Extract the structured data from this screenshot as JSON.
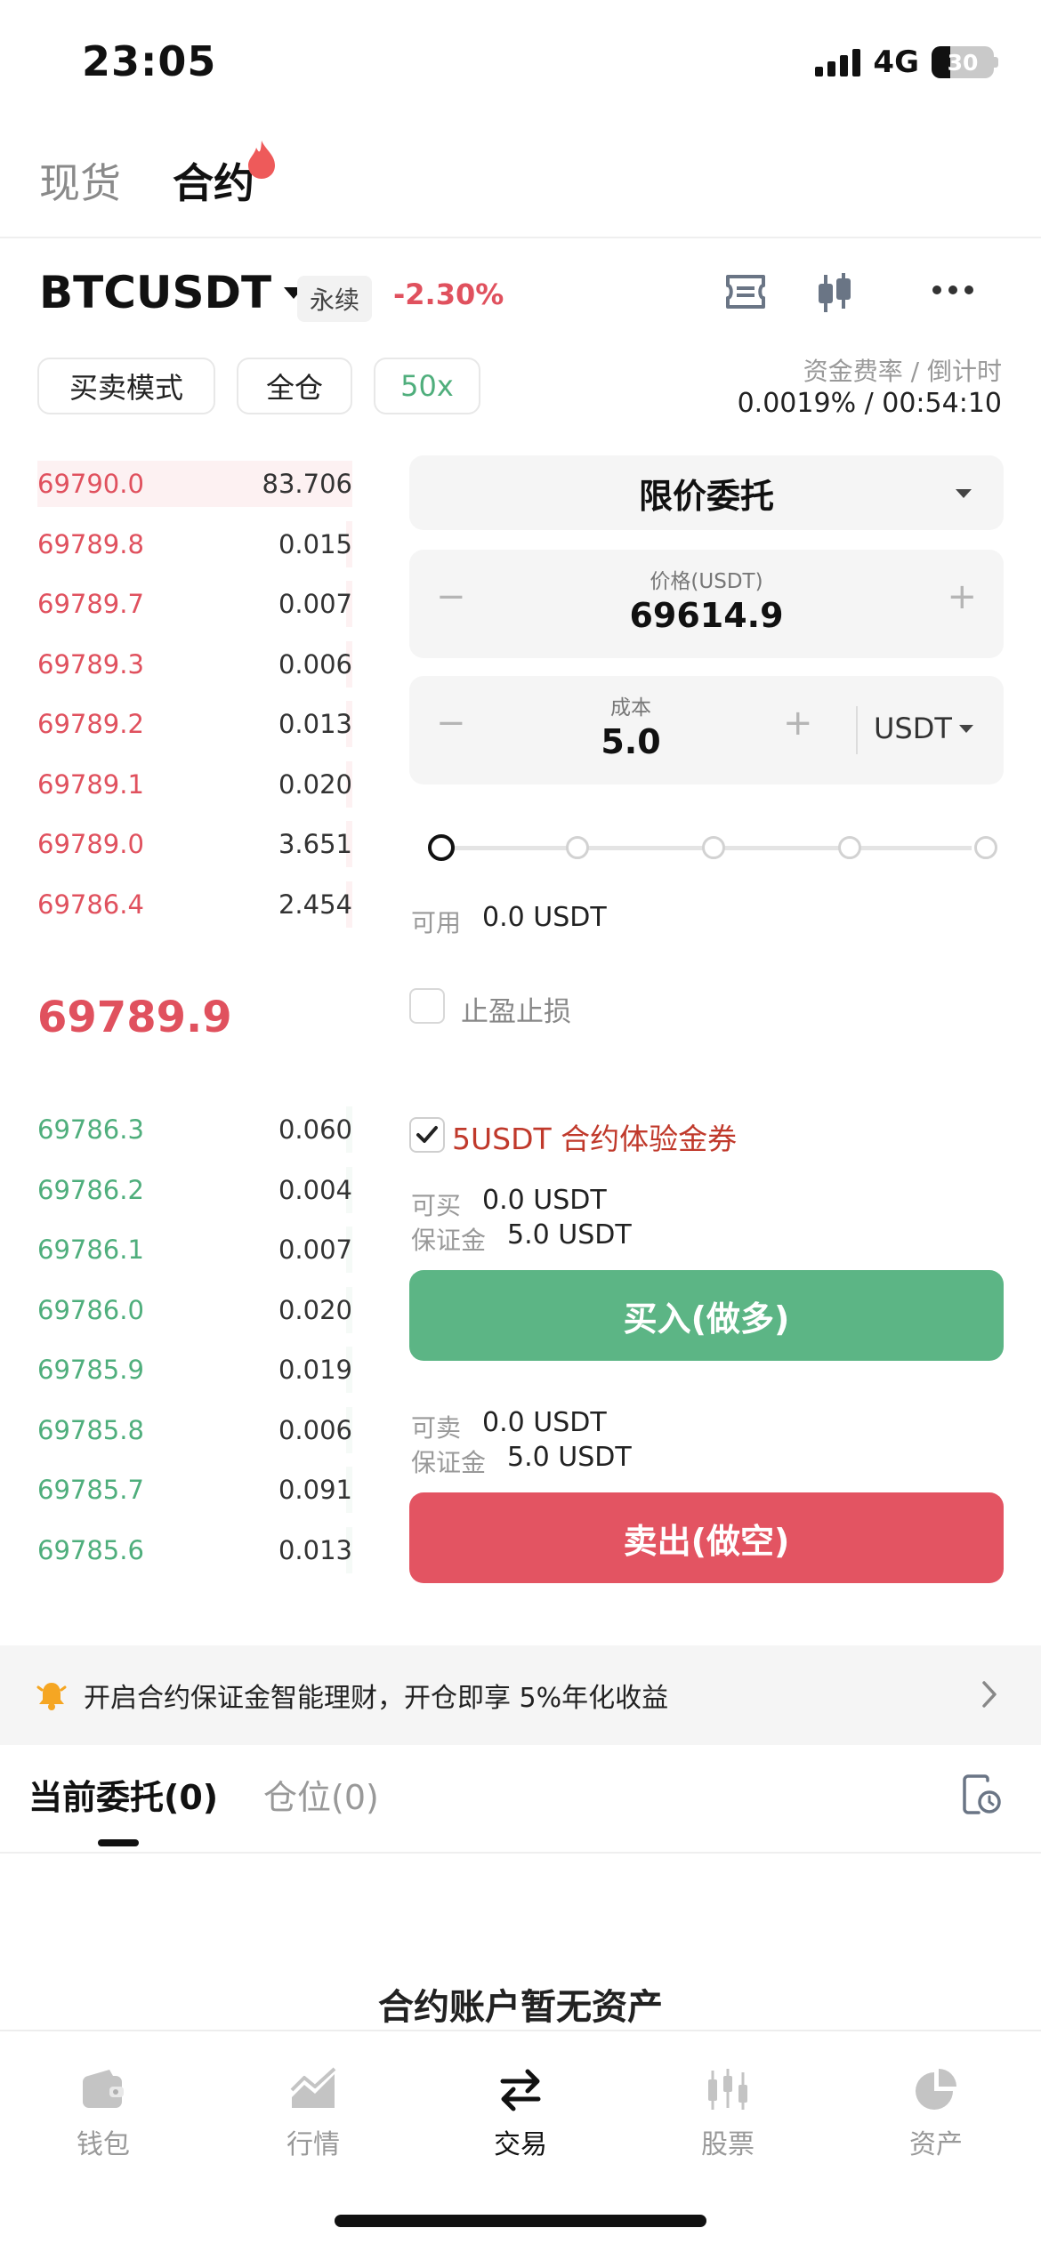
{
  "status_bar": {
    "time": "23:05",
    "network": "4G",
    "battery": "30",
    "battery_level": 0.3
  },
  "top_tabs": {
    "spot": "现货",
    "futures": "合约"
  },
  "pair": {
    "symbol": "BTCUSDT",
    "type": "永续",
    "change": "-2.30%"
  },
  "modes": {
    "trade_mode": "买卖模式",
    "margin_mode": "全仓",
    "leverage": "50x"
  },
  "funding": {
    "label": "资金费率 / 倒计时",
    "value": "0.0019% / 00:54:10"
  },
  "asks": [
    {
      "price": "69790.0",
      "qty": "83.706",
      "depth": 1.0
    },
    {
      "price": "69789.8",
      "qty": "0.015",
      "depth": 0.02
    },
    {
      "price": "69789.7",
      "qty": "0.007",
      "depth": 0.02
    },
    {
      "price": "69789.3",
      "qty": "0.006",
      "depth": 0.02
    },
    {
      "price": "69789.2",
      "qty": "0.013",
      "depth": 0.02
    },
    {
      "price": "69789.1",
      "qty": "0.020",
      "depth": 0.02
    },
    {
      "price": "69789.0",
      "qty": "3.651",
      "depth": 0.02
    },
    {
      "price": "69786.4",
      "qty": "2.454",
      "depth": 0.02
    }
  ],
  "last_price": "69789.9",
  "bids": [
    {
      "price": "69786.3",
      "qty": "0.060"
    },
    {
      "price": "69786.2",
      "qty": "0.004"
    },
    {
      "price": "69786.1",
      "qty": "0.007"
    },
    {
      "price": "69786.0",
      "qty": "0.020"
    },
    {
      "price": "69785.9",
      "qty": "0.019"
    },
    {
      "price": "69785.8",
      "qty": "0.006"
    },
    {
      "price": "69785.7",
      "qty": "0.091"
    },
    {
      "price": "69785.6",
      "qty": "0.013"
    }
  ],
  "order": {
    "type": "限价委托",
    "price_label": "价格(USDT)",
    "price_value": "69614.9",
    "cost_label": "成本",
    "cost_value": "5.0",
    "cost_unit": "USDT",
    "minus": "−",
    "plus": "+",
    "slider_level": 0
  },
  "available": {
    "label": "可用",
    "value": "0.0 USDT"
  },
  "tpsl": {
    "label": "止盈止损",
    "checked": false
  },
  "coupon": {
    "label": "5USDT 合约体验金券",
    "checked": true
  },
  "buy": {
    "can_label": "可买",
    "can_value": "0.0 USDT",
    "margin_label": "保证金",
    "margin_value": "5.0 USDT",
    "button": "买入(做多)"
  },
  "sell": {
    "can_label": "可卖",
    "can_value": "0.0 USDT",
    "margin_label": "保证金",
    "margin_value": "5.0 USDT",
    "button": "卖出(做空)"
  },
  "banner": {
    "text": "开启合约保证金智能理财，开仓即享 5%年化收益"
  },
  "sub_tabs": {
    "orders": "当前委托(0)",
    "positions": "仓位(0)"
  },
  "empty": {
    "text": "合约账户暂无资产"
  },
  "nav": {
    "items": [
      {
        "label": "钱包",
        "icon": "wallet-icon"
      },
      {
        "label": "行情",
        "icon": "market-chart-icon"
      },
      {
        "label": "交易",
        "icon": "trade-arrows-icon"
      },
      {
        "label": "股票",
        "icon": "stocks-candles-icon"
      },
      {
        "label": "资产",
        "icon": "assets-pie-icon"
      }
    ],
    "active_index": 2
  },
  "colors": {
    "ask": "#e0515e",
    "bid": "#4fae7c",
    "buy": "#5cb585",
    "sell": "#e35462",
    "coupon": "#c0392b"
  }
}
